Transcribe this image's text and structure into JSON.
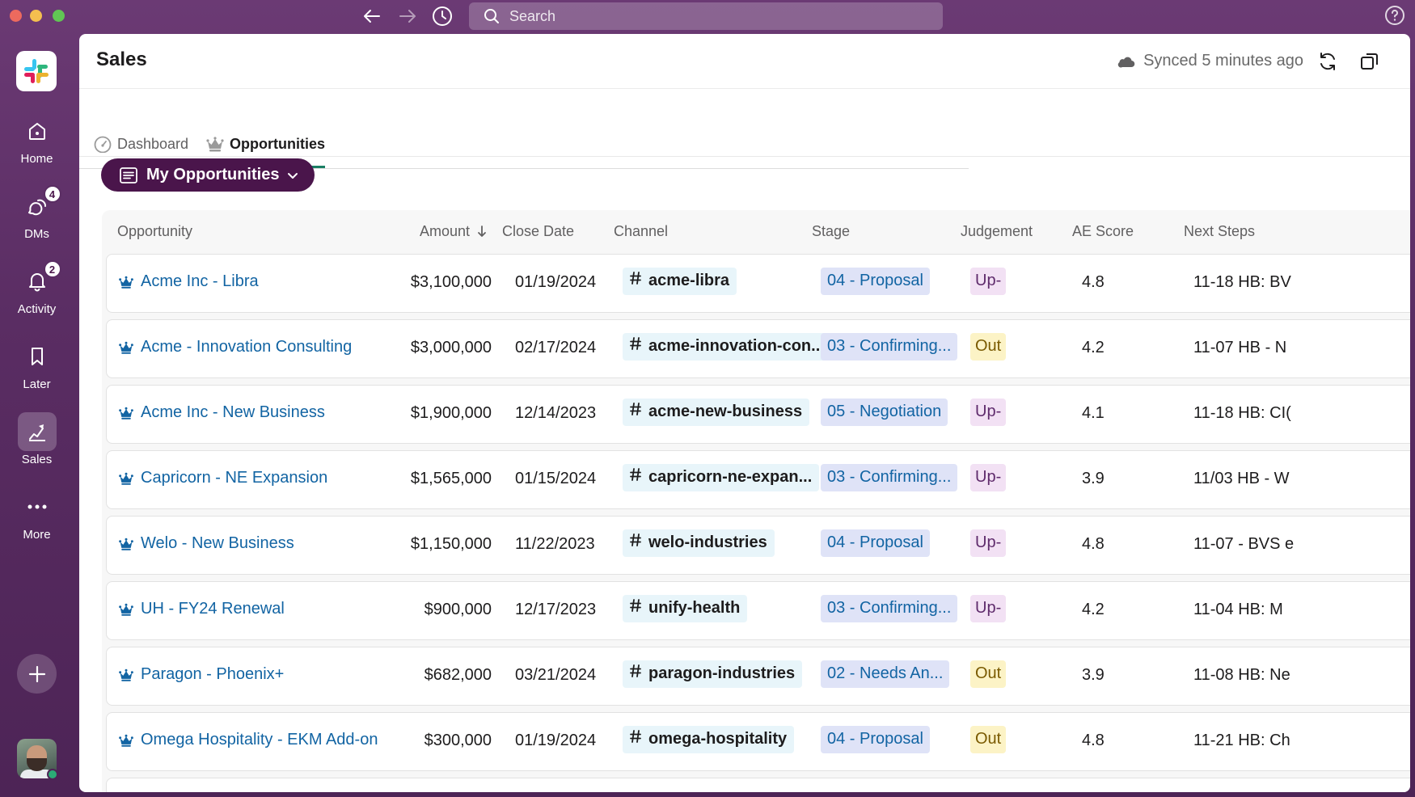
{
  "titlebar": {
    "search_placeholder": "Search"
  },
  "rail": {
    "items": [
      {
        "label": "Home",
        "icon": "home-icon"
      },
      {
        "label": "DMs",
        "icon": "dms-icon",
        "badge": "4"
      },
      {
        "label": "Activity",
        "icon": "bell-icon",
        "badge": "2"
      },
      {
        "label": "Later",
        "icon": "bookmark-icon"
      },
      {
        "label": "Sales",
        "icon": "sales-icon",
        "active": true
      },
      {
        "label": "More",
        "icon": "more-icon"
      }
    ]
  },
  "header": {
    "title": "Sales",
    "synced": "Synced 5 minutes ago"
  },
  "tabs": [
    {
      "label": "Dashboard",
      "icon": "gauge-icon"
    },
    {
      "label": "Opportunities",
      "icon": "crown-icon",
      "active": true
    }
  ],
  "view": {
    "label": "My Opportunities"
  },
  "table": {
    "columns": {
      "opportunity": "Opportunity",
      "amount": "Amount",
      "close_date": "Close Date",
      "channel": "Channel",
      "stage": "Stage",
      "judgement": "Judgement",
      "ae_score": "AE Score",
      "next_steps": "Next Steps"
    },
    "rows": [
      {
        "name": "Acme Inc - Libra",
        "amount": "$3,100,000",
        "date": "01/19/2024",
        "channel": "acme-libra",
        "stage": "04 - Proposal",
        "judgement": "Up-",
        "score": "4.8",
        "next": "11-18 HB: BV"
      },
      {
        "name": "Acme - Innovation Consulting",
        "amount": "$3,000,000",
        "date": "02/17/2024",
        "channel": "acme-innovation-con...",
        "stage": "03 - Confirming...",
        "judgement": "Out",
        "score": "4.2",
        "next": "11-07 HB - N"
      },
      {
        "name": "Acme Inc - New Business",
        "amount": "$1,900,000",
        "date": "12/14/2023",
        "channel": "acme-new-business",
        "stage": "05 - Negotiation",
        "judgement": "Up-",
        "score": "4.1",
        "next": "11-18 HB: CI("
      },
      {
        "name": "Capricorn - NE Expansion",
        "amount": "$1,565,000",
        "date": "01/15/2024",
        "channel": "capricorn-ne-expan...",
        "stage": "03 - Confirming...",
        "judgement": "Up-",
        "score": "3.9",
        "next": "11/03 HB - W"
      },
      {
        "name": "Welo - New Business",
        "amount": "$1,150,000",
        "date": "11/22/2023",
        "channel": "welo-industries",
        "stage": "04 - Proposal",
        "judgement": "Up-",
        "score": "4.8",
        "next": "11-07 - BVS e"
      },
      {
        "name": "UH - FY24 Renewal",
        "amount": "$900,000",
        "date": "12/17/2023",
        "channel": "unify-health",
        "stage": "03 - Confirming...",
        "judgement": "Up-",
        "score": "4.2",
        "next": "11-04 HB:  M"
      },
      {
        "name": "Paragon - Phoenix+",
        "amount": "$682,000",
        "date": "03/21/2024",
        "channel": "paragon-industries",
        "stage": "02 - Needs An...",
        "judgement": "Out",
        "score": "3.9",
        "next": "11-08 HB: Ne"
      },
      {
        "name": "Omega Hospitality - EKM Add-on",
        "amount": "$300,000",
        "date": "01/19/2024",
        "channel": "omega-hospitality",
        "stage": "04 - Proposal",
        "judgement": "Out",
        "score": "4.8",
        "next": "11-21 HB: Ch"
      }
    ]
  }
}
